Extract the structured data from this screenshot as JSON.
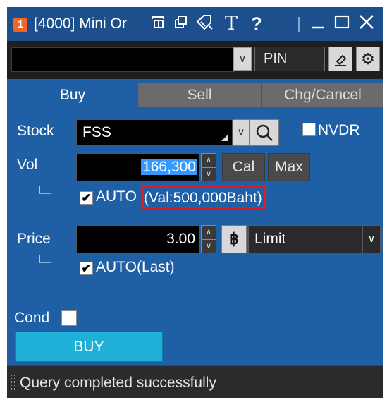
{
  "window": {
    "badge": "1",
    "title": "[4000] Mini Or",
    "icons": [
      "pin-window-icon",
      "restore-copy-icon",
      "tag-icon",
      "font-icon",
      "help-icon",
      "minimize-icon",
      "maximize-icon",
      "close-icon"
    ],
    "help_glyph": "?",
    "font_glyph": "T"
  },
  "toolbar": {
    "account_value": "",
    "pin_label": "PIN"
  },
  "tabs": [
    {
      "label": "Buy",
      "active": true
    },
    {
      "label": "Sell",
      "active": false
    },
    {
      "label": "Chg/Cancel",
      "active": false
    }
  ],
  "form": {
    "stock_label": "Stock",
    "stock_value": "FSS",
    "nvdr_label": "NVDR",
    "nvdr_checked": false,
    "vol_label": "Vol",
    "vol_value": "166,300",
    "cal_label": "Cal",
    "max_label": "Max",
    "vol_auto_label": "AUTO",
    "vol_auto_checked": true,
    "vol_auto_value_text": "(Val:500,000Baht)",
    "branch_glyph": "└─",
    "price_label": "Price",
    "price_value": "3.00",
    "baht_symbol": "฿",
    "price_type": "Limit",
    "price_auto_label": "AUTO(Last)",
    "price_auto_checked": true,
    "cond_label": "Cond",
    "cond_checked": false,
    "submit_label": "BUY"
  },
  "status": {
    "text": "Query completed successfully"
  },
  "colors": {
    "titlebar": "#1c4f8c",
    "panel": "#1f5fa6",
    "badge": "#f26522",
    "buy_button": "#1fb0d8",
    "highlight_box": "#e01b24",
    "selection": "#3399ff"
  }
}
